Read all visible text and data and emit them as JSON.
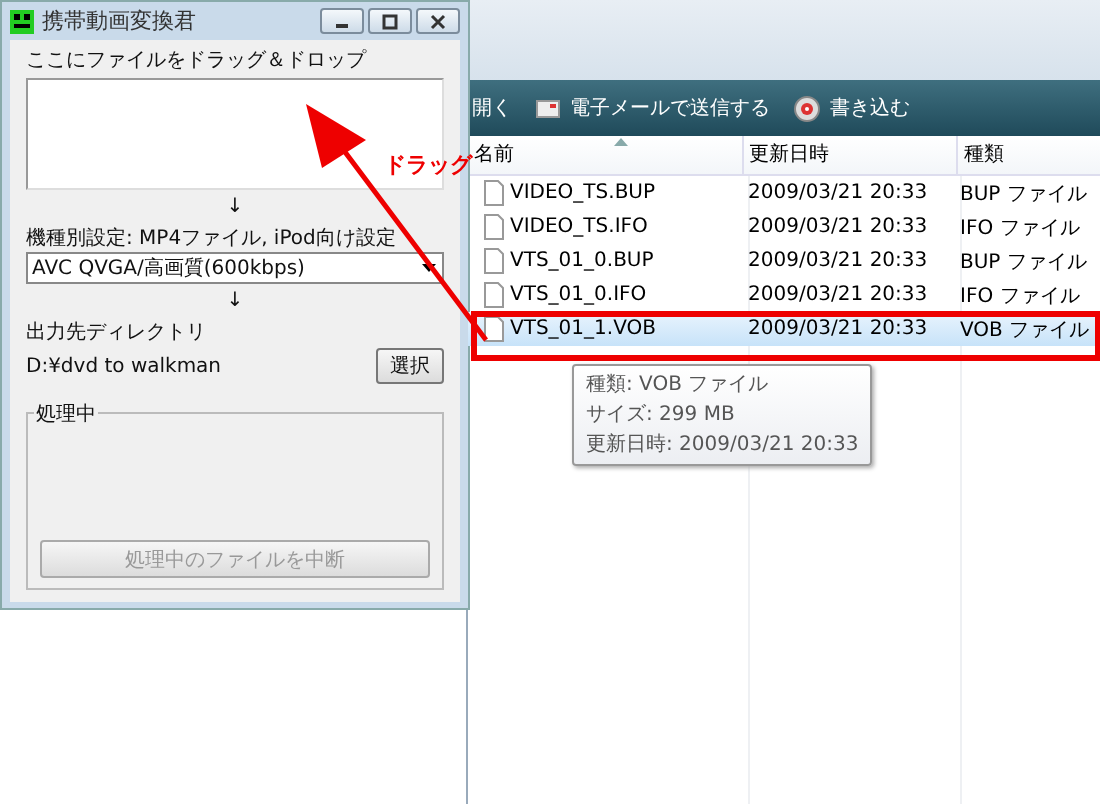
{
  "app_window": {
    "title": "携帯動画変換君",
    "drop_label": "ここにファイルをドラッグ＆ドロップ",
    "arrow_1": "↓",
    "device_label": "機種別設定: MP4ファイル, iPod向け設定",
    "preset": "AVC QVGA/高画質(600kbps)",
    "arrow_2": "↓",
    "output_label": "出力先ディレクトリ",
    "output_path": "D:¥dvd to walkman",
    "browse_button": "選択",
    "group_title": "処理中",
    "cancel_button": {
      "label": "処理中のファイルを中断",
      "disabled": true
    }
  },
  "explorer": {
    "toolbar": [
      {
        "kind": "plain",
        "label": "開く"
      },
      {
        "kind": "mail",
        "label": "電子メールで送信する"
      },
      {
        "kind": "disc",
        "label": "書き込む"
      }
    ],
    "columns": [
      "名前",
      "更新日時",
      "種類"
    ],
    "rows": [
      {
        "name": "VIDEO_TS.BUP",
        "modified": "2009/03/21 20:33",
        "type": "BUP ファイル",
        "selected": false
      },
      {
        "name": "VIDEO_TS.IFO",
        "modified": "2009/03/21 20:33",
        "type": "IFO ファイル",
        "selected": false
      },
      {
        "name": "VTS_01_0.BUP",
        "modified": "2009/03/21 20:33",
        "type": "BUP ファイル",
        "selected": false
      },
      {
        "name": "VTS_01_0.IFO",
        "modified": "2009/03/21 20:33",
        "type": "IFO ファイル",
        "selected": false
      },
      {
        "name": "VTS_01_1.VOB",
        "modified": "2009/03/21 20:33",
        "type": "VOB ファイル",
        "selected": true
      }
    ],
    "tooltip": [
      "種類: VOB ファイル",
      "サイズ: 299 MB",
      "更新日時: 2009/03/21 20:33"
    ]
  },
  "annotation": {
    "label": "ドラッグ"
  }
}
